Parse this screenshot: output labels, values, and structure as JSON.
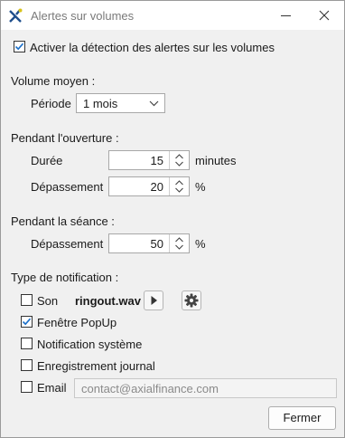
{
  "window": {
    "title": "Alertes sur volumes",
    "icons": [
      "app-logo-icon",
      "minimize-icon",
      "close-icon"
    ]
  },
  "enable_detection": {
    "label": "Activer la détection des alertes sur les volumes",
    "checked": true
  },
  "volume_moyen": {
    "heading": "Volume moyen :",
    "period_label": "Période",
    "period_value": "1 mois"
  },
  "ouverture": {
    "heading": "Pendant l'ouverture :",
    "duree_label": "Durée",
    "duree_value": "15",
    "duree_unit": "minutes",
    "depassement_label": "Dépassement",
    "depassement_value": "20",
    "depassement_unit": "%"
  },
  "seance": {
    "heading": "Pendant la séance :",
    "depassement_label": "Dépassement",
    "depassement_value": "50",
    "depassement_unit": "%"
  },
  "notification": {
    "heading": "Type de notification :",
    "son": {
      "label": "Son",
      "checked": false,
      "file": "ringout.wav",
      "icons": [
        "play-icon",
        "gear-icon"
      ]
    },
    "popup": {
      "label": "Fenêtre PopUp",
      "checked": true
    },
    "systeme": {
      "label": "Notification système",
      "checked": false
    },
    "journal": {
      "label": "Enregistrement journal",
      "checked": false
    },
    "email": {
      "label": "Email",
      "checked": false,
      "placeholder": "contact@axialfinance.com"
    }
  },
  "footer": {
    "close_label": "Fermer"
  }
}
